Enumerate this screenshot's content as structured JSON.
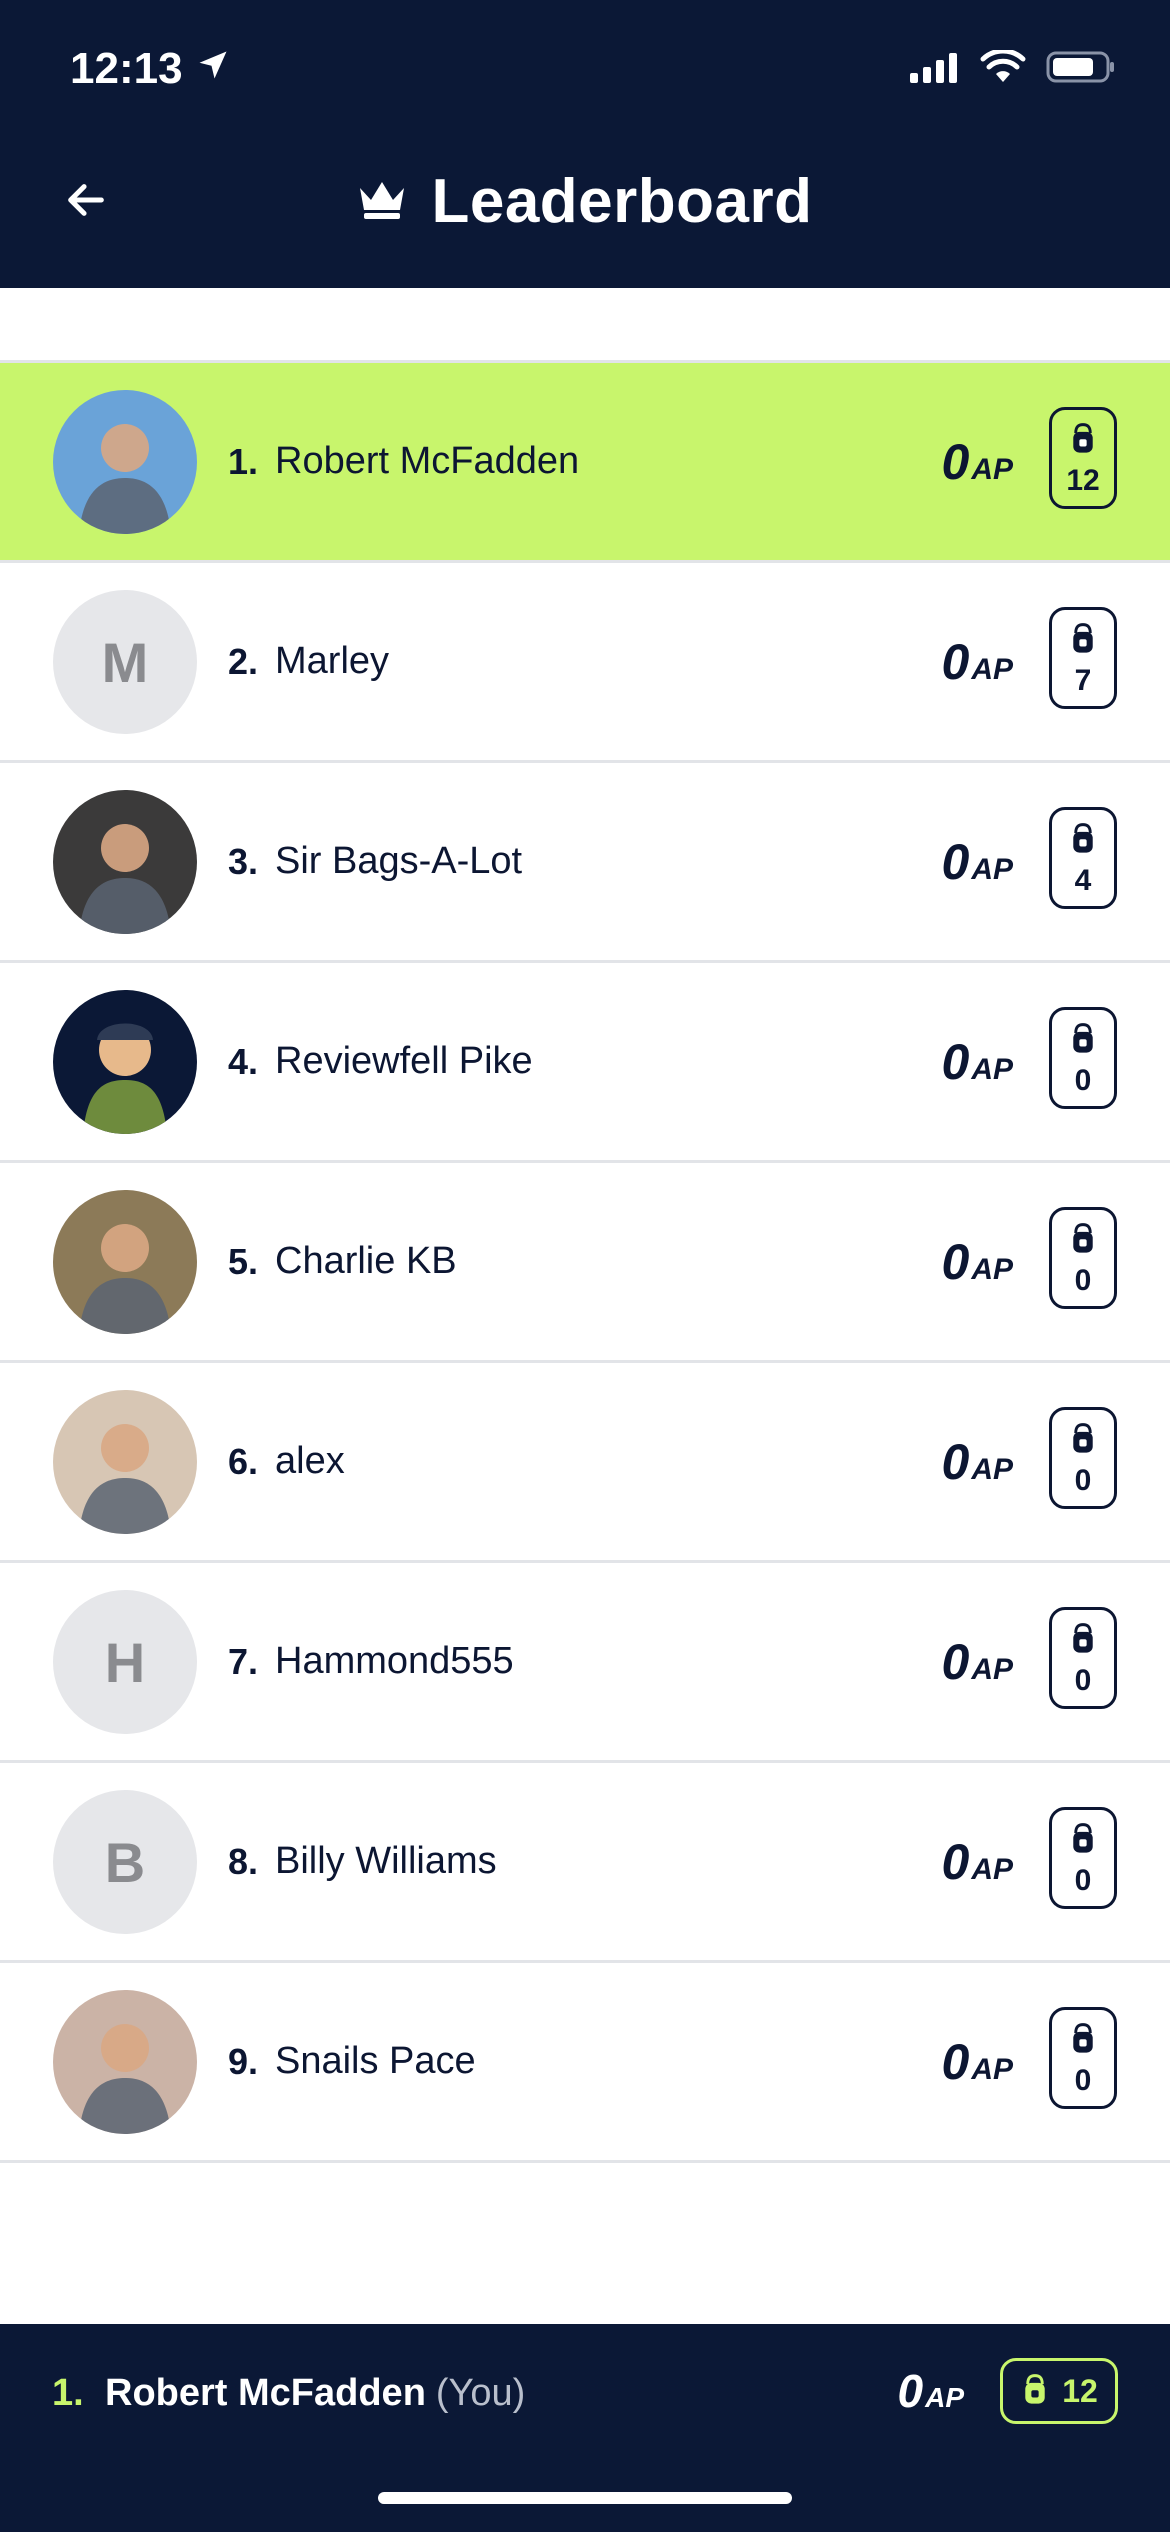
{
  "status_bar": {
    "time": "12:13"
  },
  "header": {
    "title": "Leaderboard"
  },
  "colors": {
    "navy": "#0b1836",
    "highlight": "#c8f56c",
    "divider": "#e2e4e8",
    "letter_avatar_bg": "#e6e7ea"
  },
  "icons": {
    "back": "arrow-left-icon",
    "crown": "crown-icon",
    "bag": "backpack-icon",
    "location": "location-arrow-icon"
  },
  "leaderboard": [
    {
      "rank": "1.",
      "name": "Robert McFadden",
      "ap_value": "0",
      "ap_unit": "AP",
      "bags": "12",
      "avatar": "photo",
      "highlight": true
    },
    {
      "rank": "2.",
      "name": "Marley",
      "ap_value": "0",
      "ap_unit": "AP",
      "bags": "7",
      "avatar_letter": "M"
    },
    {
      "rank": "3.",
      "name": "Sir Bags-A-Lot",
      "ap_value": "0",
      "ap_unit": "AP",
      "bags": "4",
      "avatar": "photo"
    },
    {
      "rank": "4.",
      "name": "Reviewfell Pike",
      "ap_value": "0",
      "ap_unit": "AP",
      "bags": "0",
      "avatar": "illustration"
    },
    {
      "rank": "5.",
      "name": "Charlie KB",
      "ap_value": "0",
      "ap_unit": "AP",
      "bags": "0",
      "avatar": "photo"
    },
    {
      "rank": "6.",
      "name": "alex",
      "ap_value": "0",
      "ap_unit": "AP",
      "bags": "0",
      "avatar": "photo"
    },
    {
      "rank": "7.",
      "name": "Hammond555",
      "ap_value": "0",
      "ap_unit": "AP",
      "bags": "0",
      "avatar_letter": "H"
    },
    {
      "rank": "8.",
      "name": "Billy Williams",
      "ap_value": "0",
      "ap_unit": "AP",
      "bags": "0",
      "avatar_letter": "B"
    },
    {
      "rank": "9.",
      "name": "Snails Pace",
      "ap_value": "0",
      "ap_unit": "AP",
      "bags": "0",
      "avatar": "photo"
    }
  ],
  "footer": {
    "rank": "1.",
    "name": "Robert McFadden",
    "you_label": "(You)",
    "ap_value": "0",
    "ap_unit": "AP",
    "bags": "12"
  }
}
